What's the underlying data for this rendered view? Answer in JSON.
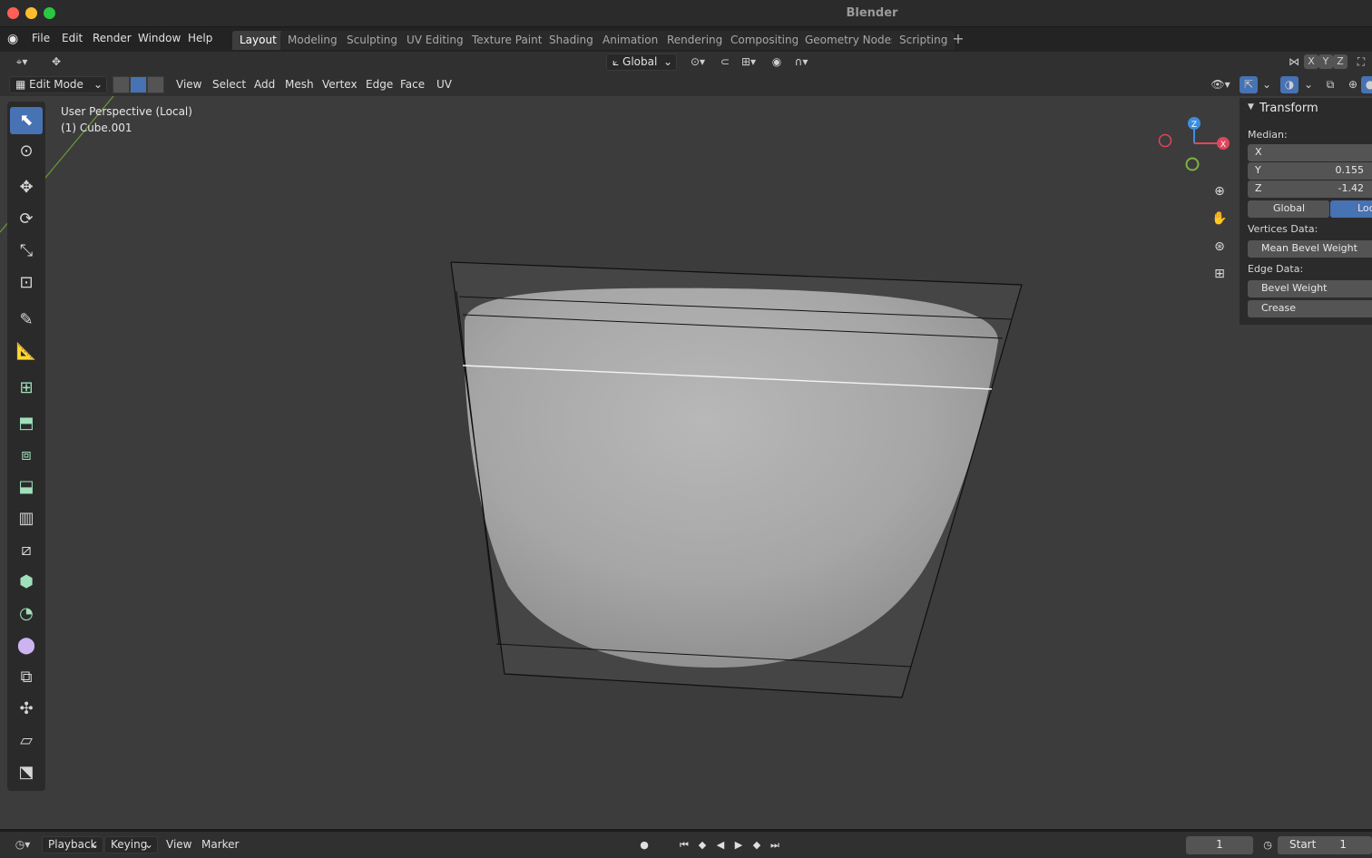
{
  "window": {
    "title": "Blender"
  },
  "menus": [
    "File",
    "Edit",
    "Render",
    "Window",
    "Help"
  ],
  "workspaces": [
    "Layout",
    "Modeling",
    "Sculpting",
    "UV Editing",
    "Texture Paint",
    "Shading",
    "Animation",
    "Rendering",
    "Compositing",
    "Geometry Nodes",
    "Scripting"
  ],
  "active_workspace": "Layout",
  "header": {
    "orientation": "Global",
    "axis_x": "X",
    "axis_y": "Y",
    "axis_z": "Z"
  },
  "editbar": {
    "mode": "Edit Mode",
    "menus": [
      "View",
      "Select",
      "Add",
      "Mesh",
      "Vertex",
      "Edge",
      "Face",
      "UV"
    ]
  },
  "viewport": {
    "perspective": "User Perspective (Local)",
    "object": "(1) Cube.001",
    "gizmo": {
      "x": "X",
      "y": "Y",
      "z": "Z"
    }
  },
  "npanel": {
    "title": "Transform",
    "median_label": "Median:",
    "fields": [
      {
        "label": "X",
        "value": ""
      },
      {
        "label": "Y",
        "value": "0.155"
      },
      {
        "label": "Z",
        "value": "-1.42"
      }
    ],
    "space_global": "Global",
    "space_local": "Loc",
    "vertices_label": "Vertices Data:",
    "mean_bevel": "Mean Bevel Weight",
    "edge_label": "Edge Data:",
    "bevel_weight": "Bevel Weight",
    "crease": "Crease"
  },
  "timeline": {
    "playback": "Playback",
    "keying": "Keying",
    "view": "View",
    "marker": "Marker",
    "current_frame": "1",
    "start_label": "Start",
    "start_value": "1"
  },
  "colors": {
    "accent": "#4772b3",
    "axis_x": "#e0455c",
    "axis_y": "#7cb342",
    "axis_z": "#3b8ee0"
  }
}
